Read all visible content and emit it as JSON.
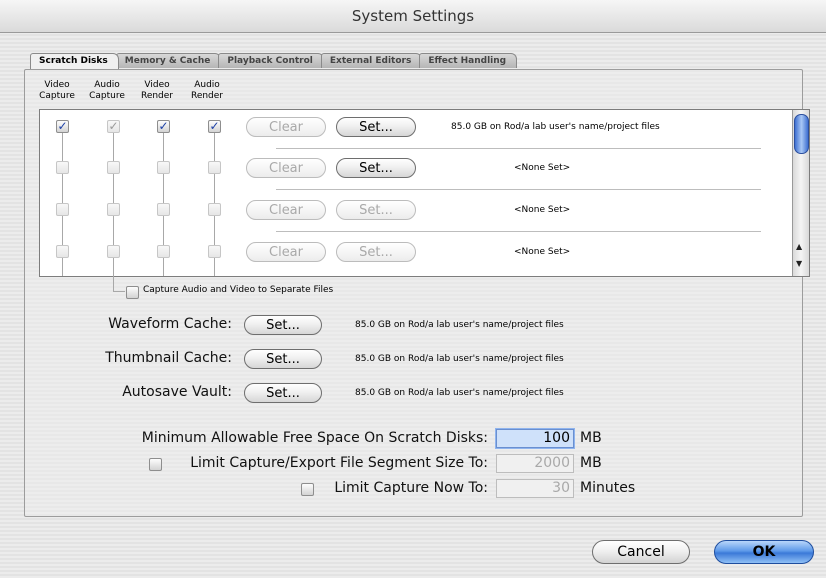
{
  "window": {
    "title": "System Settings"
  },
  "tabs": [
    {
      "label": "Scratch Disks"
    },
    {
      "label": "Memory & Cache"
    },
    {
      "label": "Playback Control"
    },
    {
      "label": "External Editors"
    },
    {
      "label": "Effect Handling"
    }
  ],
  "columns": [
    {
      "line1": "Video",
      "line2": "Capture"
    },
    {
      "line1": "Audio",
      "line2": "Capture"
    },
    {
      "line1": "Video",
      "line2": "Render"
    },
    {
      "line1": "Audio",
      "line2": "Render"
    }
  ],
  "scratch_rows": [
    {
      "clear_label": "Clear",
      "set_label": "Set...",
      "path": "85.0 GB on Rod/a lab user's name/project files"
    },
    {
      "clear_label": "Clear",
      "set_label": "Set...",
      "path": "<None Set>"
    },
    {
      "clear_label": "Clear",
      "set_label": "Set...",
      "path": "<None Set>"
    },
    {
      "clear_label": "Clear",
      "set_label": "Set...",
      "path": "<None Set>"
    }
  ],
  "capture_separate": {
    "label": "Capture Audio and Video to Separate Files",
    "checked": false
  },
  "caches": [
    {
      "label": "Waveform Cache:",
      "set_label": "Set...",
      "path": "85.0 GB on Rod/a lab user's name/project files"
    },
    {
      "label": "Thumbnail Cache:",
      "set_label": "Set...",
      "path": "85.0 GB on Rod/a lab user's name/project files"
    },
    {
      "label": "Autosave Vault:",
      "set_label": "Set...",
      "path": "85.0 GB on Rod/a lab user's name/project files"
    }
  ],
  "min_free": {
    "label": "Minimum Allowable Free Space On Scratch Disks:",
    "value": "100",
    "unit": "MB"
  },
  "limit_segment": {
    "label": "Limit Capture/Export File Segment Size To:",
    "value": "2000",
    "unit": "MB",
    "checked": false
  },
  "limit_capture": {
    "label": "Limit Capture Now To:",
    "value": "30",
    "unit": "Minutes",
    "checked": false
  },
  "buttons": {
    "cancel": "Cancel",
    "ok": "OK"
  },
  "icons": {
    "check": "checkmark-icon",
    "scroll_up": "arrow-up-icon",
    "scroll_down": "arrow-down-icon"
  }
}
